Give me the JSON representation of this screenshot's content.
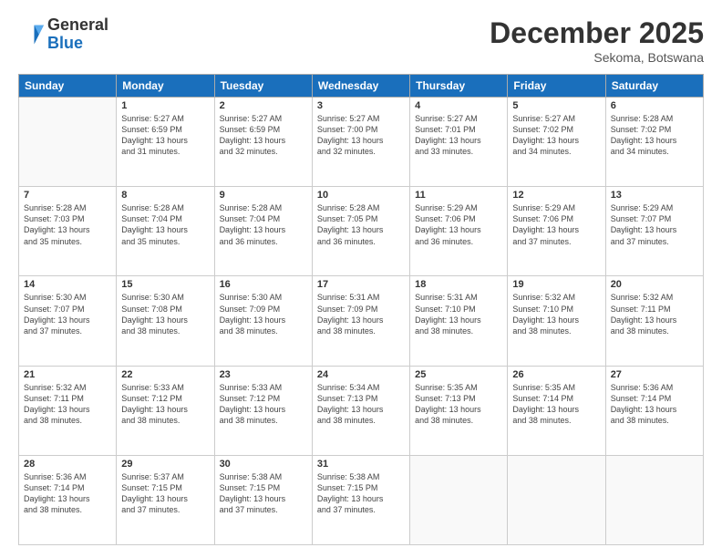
{
  "logo": {
    "general": "General",
    "blue": "Blue"
  },
  "header": {
    "month": "December 2025",
    "location": "Sekoma, Botswana"
  },
  "weekdays": [
    "Sunday",
    "Monday",
    "Tuesday",
    "Wednesday",
    "Thursday",
    "Friday",
    "Saturday"
  ],
  "weeks": [
    [
      {
        "day": "",
        "info": ""
      },
      {
        "day": "1",
        "info": "Sunrise: 5:27 AM\nSunset: 6:59 PM\nDaylight: 13 hours\nand 31 minutes."
      },
      {
        "day": "2",
        "info": "Sunrise: 5:27 AM\nSunset: 6:59 PM\nDaylight: 13 hours\nand 32 minutes."
      },
      {
        "day": "3",
        "info": "Sunrise: 5:27 AM\nSunset: 7:00 PM\nDaylight: 13 hours\nand 32 minutes."
      },
      {
        "day": "4",
        "info": "Sunrise: 5:27 AM\nSunset: 7:01 PM\nDaylight: 13 hours\nand 33 minutes."
      },
      {
        "day": "5",
        "info": "Sunrise: 5:27 AM\nSunset: 7:02 PM\nDaylight: 13 hours\nand 34 minutes."
      },
      {
        "day": "6",
        "info": "Sunrise: 5:28 AM\nSunset: 7:02 PM\nDaylight: 13 hours\nand 34 minutes."
      }
    ],
    [
      {
        "day": "7",
        "info": "Sunrise: 5:28 AM\nSunset: 7:03 PM\nDaylight: 13 hours\nand 35 minutes."
      },
      {
        "day": "8",
        "info": "Sunrise: 5:28 AM\nSunset: 7:04 PM\nDaylight: 13 hours\nand 35 minutes."
      },
      {
        "day": "9",
        "info": "Sunrise: 5:28 AM\nSunset: 7:04 PM\nDaylight: 13 hours\nand 36 minutes."
      },
      {
        "day": "10",
        "info": "Sunrise: 5:28 AM\nSunset: 7:05 PM\nDaylight: 13 hours\nand 36 minutes."
      },
      {
        "day": "11",
        "info": "Sunrise: 5:29 AM\nSunset: 7:06 PM\nDaylight: 13 hours\nand 36 minutes."
      },
      {
        "day": "12",
        "info": "Sunrise: 5:29 AM\nSunset: 7:06 PM\nDaylight: 13 hours\nand 37 minutes."
      },
      {
        "day": "13",
        "info": "Sunrise: 5:29 AM\nSunset: 7:07 PM\nDaylight: 13 hours\nand 37 minutes."
      }
    ],
    [
      {
        "day": "14",
        "info": "Sunrise: 5:30 AM\nSunset: 7:07 PM\nDaylight: 13 hours\nand 37 minutes."
      },
      {
        "day": "15",
        "info": "Sunrise: 5:30 AM\nSunset: 7:08 PM\nDaylight: 13 hours\nand 38 minutes."
      },
      {
        "day": "16",
        "info": "Sunrise: 5:30 AM\nSunset: 7:09 PM\nDaylight: 13 hours\nand 38 minutes."
      },
      {
        "day": "17",
        "info": "Sunrise: 5:31 AM\nSunset: 7:09 PM\nDaylight: 13 hours\nand 38 minutes."
      },
      {
        "day": "18",
        "info": "Sunrise: 5:31 AM\nSunset: 7:10 PM\nDaylight: 13 hours\nand 38 minutes."
      },
      {
        "day": "19",
        "info": "Sunrise: 5:32 AM\nSunset: 7:10 PM\nDaylight: 13 hours\nand 38 minutes."
      },
      {
        "day": "20",
        "info": "Sunrise: 5:32 AM\nSunset: 7:11 PM\nDaylight: 13 hours\nand 38 minutes."
      }
    ],
    [
      {
        "day": "21",
        "info": "Sunrise: 5:32 AM\nSunset: 7:11 PM\nDaylight: 13 hours\nand 38 minutes."
      },
      {
        "day": "22",
        "info": "Sunrise: 5:33 AM\nSunset: 7:12 PM\nDaylight: 13 hours\nand 38 minutes."
      },
      {
        "day": "23",
        "info": "Sunrise: 5:33 AM\nSunset: 7:12 PM\nDaylight: 13 hours\nand 38 minutes."
      },
      {
        "day": "24",
        "info": "Sunrise: 5:34 AM\nSunset: 7:13 PM\nDaylight: 13 hours\nand 38 minutes."
      },
      {
        "day": "25",
        "info": "Sunrise: 5:35 AM\nSunset: 7:13 PM\nDaylight: 13 hours\nand 38 minutes."
      },
      {
        "day": "26",
        "info": "Sunrise: 5:35 AM\nSunset: 7:14 PM\nDaylight: 13 hours\nand 38 minutes."
      },
      {
        "day": "27",
        "info": "Sunrise: 5:36 AM\nSunset: 7:14 PM\nDaylight: 13 hours\nand 38 minutes."
      }
    ],
    [
      {
        "day": "28",
        "info": "Sunrise: 5:36 AM\nSunset: 7:14 PM\nDaylight: 13 hours\nand 38 minutes."
      },
      {
        "day": "29",
        "info": "Sunrise: 5:37 AM\nSunset: 7:15 PM\nDaylight: 13 hours\nand 37 minutes."
      },
      {
        "day": "30",
        "info": "Sunrise: 5:38 AM\nSunset: 7:15 PM\nDaylight: 13 hours\nand 37 minutes."
      },
      {
        "day": "31",
        "info": "Sunrise: 5:38 AM\nSunset: 7:15 PM\nDaylight: 13 hours\nand 37 minutes."
      },
      {
        "day": "",
        "info": ""
      },
      {
        "day": "",
        "info": ""
      },
      {
        "day": "",
        "info": ""
      }
    ]
  ]
}
